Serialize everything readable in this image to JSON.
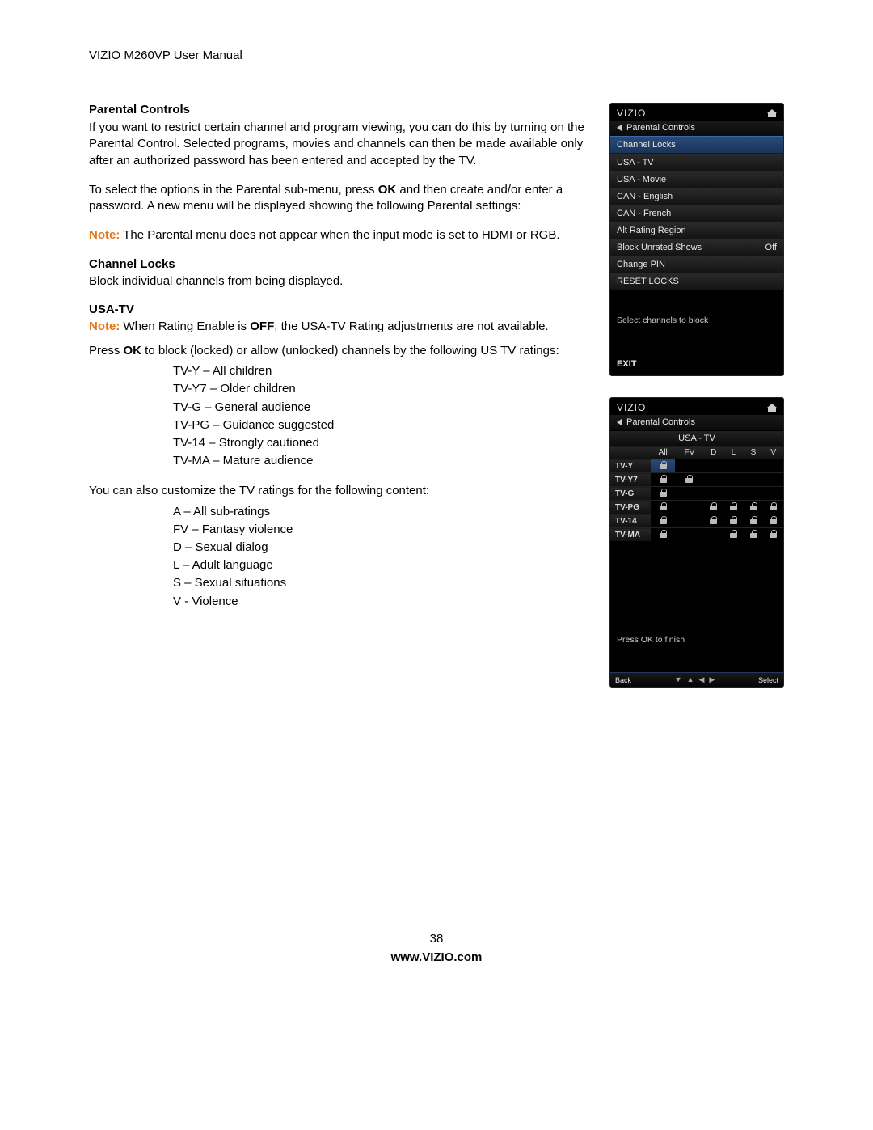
{
  "header": {
    "manual_title": "VIZIO M260VP User Manual"
  },
  "sections": {
    "parental_controls": {
      "heading": "Parental Controls",
      "para1": "If you want to restrict certain channel and program viewing, you can do this by turning on the Parental Control. Selected programs, movies and channels can then be made available only after an authorized password has been entered and accepted by the TV.",
      "para2_pre": "To select the options in the Parental sub-menu, press ",
      "para2_ok": "OK",
      "para2_post": " and then create and/or enter a password. A new menu will be displayed showing the following Parental settings:",
      "note_label": "Note:",
      "note_text": " The Parental menu does not appear when the input mode is set to HDMI or RGB."
    },
    "channel_locks": {
      "heading": "Channel Locks",
      "text": "Block individual channels from being displayed."
    },
    "usa_tv": {
      "heading": "USA-TV",
      "note_label": "Note:",
      "note_text_pre": " When Rating Enable is ",
      "note_off": "OFF",
      "note_text_post": ", the USA-TV Rating adjustments are not available.",
      "para_pre": "Press ",
      "para_ok": "OK",
      "para_post": " to block (locked) or allow (unlocked) channels by the following US TV ratings:",
      "ratings_list": "TV-Y – All children\nTV-Y7 – Older children\nTV-G – General audience\nTV-PG – Guidance suggested\nTV-14 – Strongly cautioned\nTV-MA – Mature audience",
      "custom_intro": "You can also customize the TV ratings for the following content:",
      "custom_list": "A – All sub-ratings\nFV – Fantasy violence\nD – Sexual dialog\nL – Adult language\nS – Sexual situations\nV - Violence"
    }
  },
  "osd1": {
    "brand": "VIZIO",
    "breadcrumb": "Parental Controls",
    "rows": {
      "channel_locks": "Channel Locks",
      "usa_tv": "USA - TV",
      "usa_movie": "USA - Movie",
      "can_english": "CAN - English",
      "can_french": "CAN - French",
      "alt_rating": "Alt Rating Region",
      "block_unrated": "Block Unrated Shows",
      "block_unrated_val": "Off",
      "change_pin": "Change PIN",
      "reset_locks": "RESET LOCKS"
    },
    "hint": "Select channels to block",
    "exit": "EXIT"
  },
  "osd2": {
    "brand": "VIZIO",
    "breadcrumb": "Parental Controls",
    "subhead": "USA - TV",
    "cols": {
      "all": "All",
      "fv": "FV",
      "d": "D",
      "l": "L",
      "s": "S",
      "v": "V"
    },
    "rows": {
      "tvy": "TV-Y",
      "tvy7": "TV-Y7",
      "tvg": "TV-G",
      "tvpg": "TV-PG",
      "tv14": "TV-14",
      "tvma": "TV-MA"
    },
    "locks": {
      "tvy": {
        "all": true,
        "fv": false,
        "d": false,
        "l": false,
        "s": false,
        "v": false
      },
      "tvy7": {
        "all": true,
        "fv": true,
        "d": false,
        "l": false,
        "s": false,
        "v": false
      },
      "tvg": {
        "all": true,
        "fv": false,
        "d": false,
        "l": false,
        "s": false,
        "v": false
      },
      "tvpg": {
        "all": true,
        "fv": false,
        "d": true,
        "l": true,
        "s": true,
        "v": true
      },
      "tv14": {
        "all": true,
        "fv": false,
        "d": true,
        "l": true,
        "s": true,
        "v": true
      },
      "tvma": {
        "all": true,
        "fv": false,
        "d": false,
        "l": true,
        "s": true,
        "v": true
      }
    },
    "hint": "Press OK to finish",
    "bottom": {
      "back": "Back",
      "select": "Select"
    }
  },
  "footer": {
    "page": "38",
    "url": "www.VIZIO.com"
  }
}
